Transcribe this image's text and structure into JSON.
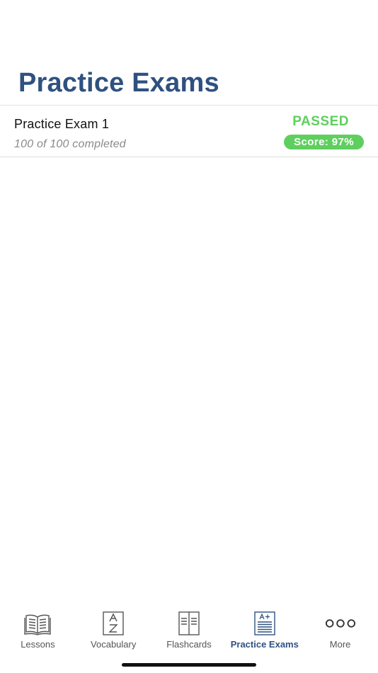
{
  "header": {
    "title": "Practice Exams"
  },
  "exams": [
    {
      "name": "Practice Exam 1",
      "progress": "100 of 100 completed",
      "status": "PASSED",
      "score": "Score: 97%"
    }
  ],
  "tab_bar": {
    "tabs": [
      {
        "label": "Lessons",
        "icon": "book-icon",
        "active": false
      },
      {
        "label": "Vocabulary",
        "icon": "a-z-dictionary-icon",
        "active": false
      },
      {
        "label": "Flashcards",
        "icon": "flashcards-icon",
        "active": false
      },
      {
        "label": "Practice Exams",
        "icon": "exam-a-plus-icon",
        "active": true
      },
      {
        "label": "More",
        "icon": "more-dots-icon",
        "active": false
      }
    ]
  },
  "colors": {
    "title": "#2f5180",
    "passed": "#5ecf5e",
    "active_tab": "#2f5180",
    "inactive_tab": "#555555"
  }
}
